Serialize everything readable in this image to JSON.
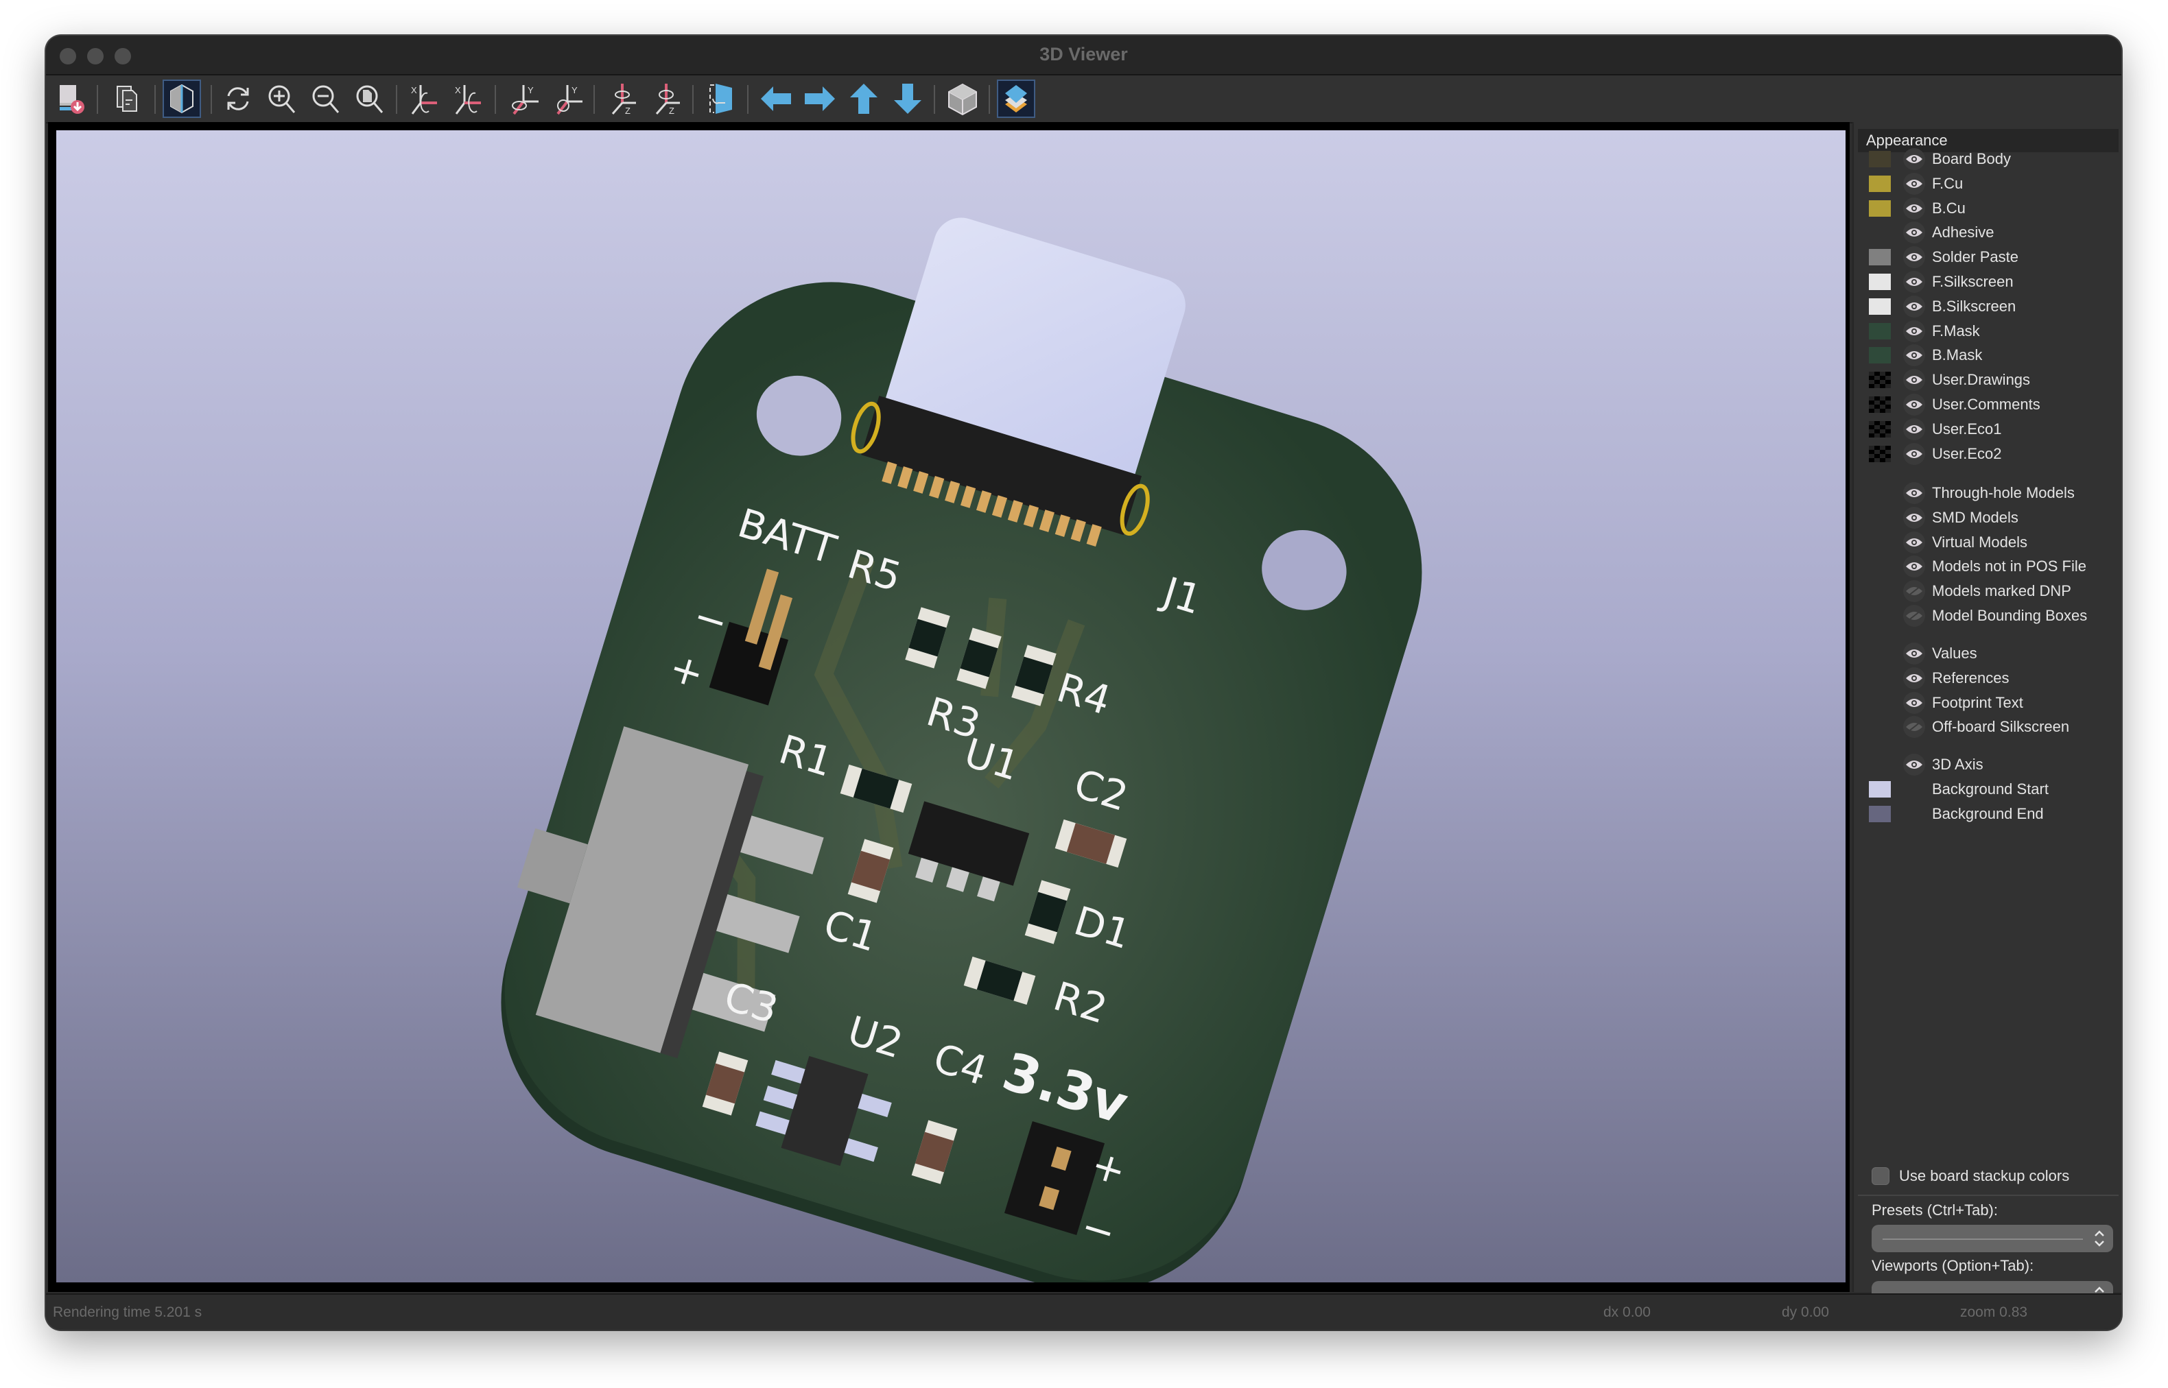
{
  "window": {
    "title": "3D Viewer"
  },
  "toolbar": {
    "buttons": [
      {
        "name": "export-image-button",
        "icon": "export-icon",
        "tooltip_label": "Export"
      },
      {
        "name": "copy-to-clipboard-button",
        "icon": "copy-icon"
      },
      {
        "name": "raytracing-button",
        "icon": "raytrace-cube-icon",
        "active": true
      },
      {
        "name": "reload-button",
        "icon": "refresh-icon"
      },
      {
        "name": "zoom-in-button",
        "icon": "zoom-in-icon"
      },
      {
        "name": "zoom-out-button",
        "icon": "zoom-out-icon"
      },
      {
        "name": "zoom-fit-button",
        "icon": "zoom-fit-icon"
      },
      {
        "name": "rotate-x-cw-button",
        "icon": "rotate-x-cw-icon"
      },
      {
        "name": "rotate-x-ccw-button",
        "icon": "rotate-x-ccw-icon"
      },
      {
        "name": "rotate-y-cw-button",
        "icon": "rotate-y-cw-icon"
      },
      {
        "name": "rotate-y-ccw-button",
        "icon": "rotate-y-ccw-icon"
      },
      {
        "name": "rotate-z-cw-button",
        "icon": "rotate-z-cw-icon"
      },
      {
        "name": "rotate-z-ccw-button",
        "icon": "rotate-z-ccw-icon"
      },
      {
        "name": "flip-board-button",
        "icon": "flip-board-icon"
      },
      {
        "name": "pan-left-button",
        "icon": "arrow-left-icon"
      },
      {
        "name": "pan-right-button",
        "icon": "arrow-right-icon"
      },
      {
        "name": "pan-up-button",
        "icon": "arrow-up-icon"
      },
      {
        "name": "pan-down-button",
        "icon": "arrow-down-icon"
      },
      {
        "name": "ortho-toggle-button",
        "icon": "ortho-cube-icon"
      },
      {
        "name": "layers-manager-button",
        "icon": "layers-icon",
        "active": true
      }
    ]
  },
  "viewport": {
    "background_start": "#cbcce6",
    "background_end": "#6c6d88",
    "board_labels": {
      "batt": "BATT",
      "r5": "R5",
      "r4": "R4",
      "r3": "R3",
      "r1": "R1",
      "u1": "U1",
      "c2": "C2",
      "c1": "C1",
      "d1": "D1",
      "r2": "R2",
      "c3": "C3",
      "u2": "U2",
      "c4": "C4",
      "voltage": "3.3v",
      "j1": "J1",
      "plus": "+",
      "minus": "−"
    }
  },
  "appearance": {
    "header": "Appearance",
    "layers": [
      {
        "label": "Board Body",
        "color": "#443f2e",
        "visible": true
      },
      {
        "label": "F.Cu",
        "color": "#b09d35",
        "visible": true
      },
      {
        "label": "B.Cu",
        "color": "#b09d35",
        "visible": true
      },
      {
        "label": "Adhesive",
        "color": null,
        "visible": true
      },
      {
        "label": "Solder Paste",
        "color": "#808080",
        "visible": true
      },
      {
        "label": "F.Silkscreen",
        "color": "#e6e6e6",
        "visible": true
      },
      {
        "label": "B.Silkscreen",
        "color": "#e6e6e6",
        "visible": true
      },
      {
        "label": "F.Mask",
        "color": "#2f4a3a",
        "visible": true
      },
      {
        "label": "B.Mask",
        "color": "#2f4a3a",
        "visible": true
      },
      {
        "label": "User.Drawings",
        "color": "checker",
        "visible": true
      },
      {
        "label": "User.Comments",
        "color": "checker",
        "visible": true
      },
      {
        "label": "User.Eco1",
        "color": "checker",
        "visible": true
      },
      {
        "label": "User.Eco2",
        "color": "checker",
        "visible": true
      }
    ],
    "models": [
      {
        "label": "Through-hole Models",
        "visible": true
      },
      {
        "label": "SMD Models",
        "visible": true
      },
      {
        "label": "Virtual Models",
        "visible": true
      },
      {
        "label": "Models not in POS File",
        "visible": true
      },
      {
        "label": "Models marked DNP",
        "visible": false
      },
      {
        "label": "Model Bounding Boxes",
        "visible": false
      }
    ],
    "text": [
      {
        "label": "Values",
        "visible": true
      },
      {
        "label": "References",
        "visible": true
      },
      {
        "label": "Footprint Text",
        "visible": true
      },
      {
        "label": "Off-board Silkscreen",
        "visible": false
      }
    ],
    "misc": [
      {
        "label": "3D Axis",
        "visible": true,
        "color": null
      },
      {
        "label": "Background Start",
        "visible": null,
        "color": "#cbcce6"
      },
      {
        "label": "Background End",
        "visible": null,
        "color": "#66667f"
      }
    ],
    "use_stackup_colors": {
      "label": "Use board stackup colors",
      "checked": false
    },
    "presets": {
      "label": "Presets (Ctrl+Tab):",
      "value": ""
    },
    "viewports": {
      "label": "Viewports (Option+Tab):",
      "value": ""
    }
  },
  "status": {
    "rendering_time": "Rendering time 5.201 s",
    "dx": "dx 0.00",
    "dy": "dy 0.00",
    "zoom": "zoom 0.83"
  }
}
